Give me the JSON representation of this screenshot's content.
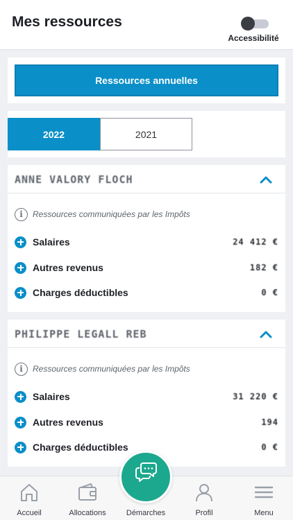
{
  "header": {
    "title": "Mes ressources",
    "accessibility_label": "Accessibilité"
  },
  "annual": {
    "button_label": "Ressources annuelles"
  },
  "years": {
    "tabs": [
      {
        "label": "2022",
        "selected": true
      },
      {
        "label": "2021",
        "selected": false
      }
    ]
  },
  "people": [
    {
      "name": "ANNE VALORY FLOCH",
      "info_text": "Ressources communiquées par les Impôts",
      "rows": [
        {
          "label": "Salaires",
          "value": "24 412 €"
        },
        {
          "label": "Autres revenus",
          "value": "182 €"
        },
        {
          "label": "Charges déductibles",
          "value": "0 €"
        }
      ]
    },
    {
      "name": "PHILIPPE LEGALL REB",
      "info_text": "Ressources communiquées par les Impôts",
      "rows": [
        {
          "label": "Salaires",
          "value": "31 220 €"
        },
        {
          "label": "Autres revenus",
          "value": "194"
        },
        {
          "label": "Charges déductibles",
          "value": "0 €"
        }
      ]
    }
  ],
  "nav": {
    "items": [
      {
        "label": "Accueil",
        "icon": "home-icon"
      },
      {
        "label": "Allocations",
        "icon": "wallet-icon"
      },
      {
        "label": "Démarches",
        "icon": "document-edit-icon"
      },
      {
        "label": "Profil",
        "icon": "user-icon"
      },
      {
        "label": "Menu",
        "icon": "hamburger-menu-icon"
      }
    ]
  },
  "colors": {
    "accent": "#0a8fc8",
    "chat": "#1ca88e",
    "background": "#eef0f3"
  }
}
